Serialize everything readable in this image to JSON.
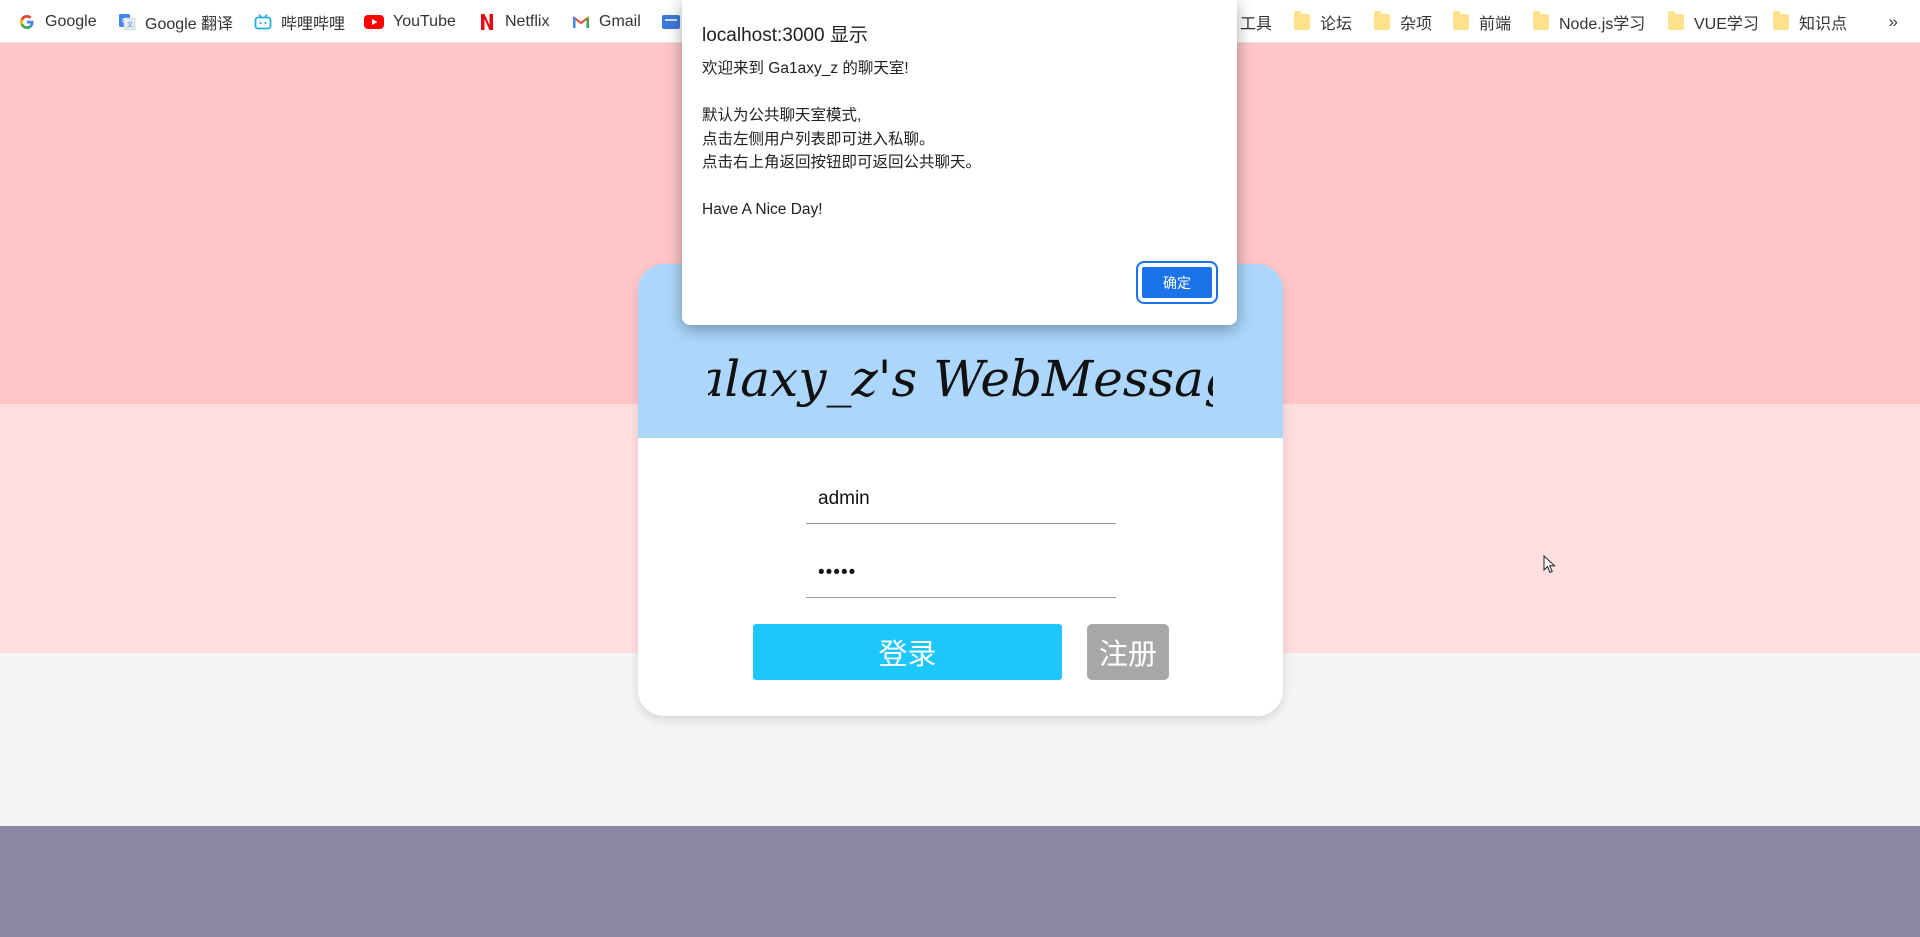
{
  "bookmarks": [
    {
      "label": "Google",
      "icon": "google-icon"
    },
    {
      "label": "Google 翻译",
      "icon": "google-translate-icon"
    },
    {
      "label": "哔哩哔哩",
      "icon": "bilibili-icon"
    },
    {
      "label": "YouTube",
      "icon": "youtube-icon"
    },
    {
      "label": "Netflix",
      "icon": "netflix-icon"
    },
    {
      "label": "Gmail",
      "icon": "gmail-icon"
    },
    {
      "label": "工具",
      "icon": "folder-icon"
    },
    {
      "label": "论坛",
      "icon": "folder-icon"
    },
    {
      "label": "杂项",
      "icon": "folder-icon"
    },
    {
      "label": "前端",
      "icon": "folder-icon"
    },
    {
      "label": "Node.js学习",
      "icon": "folder-icon"
    },
    {
      "label": "VUE学习",
      "icon": "folder-icon"
    },
    {
      "label": "知识点",
      "icon": "folder-icon"
    }
  ],
  "overflow_label": "»",
  "dialog": {
    "title": "localhost:3000 显示",
    "lines": [
      "欢迎来到 Ga1axy_z 的聊天室!",
      "",
      "默认为公共聊天室模式,",
      "点击左侧用户列表即可进入私聊。",
      "点击右上角返回按钮即可返回公共聊天。",
      "",
      "Have A Nice Day!"
    ],
    "ok_label": "确定"
  },
  "login": {
    "logo_text": "Galaxy_z's WebMessage",
    "username_value": "admin",
    "password_value": "•••••",
    "login_label": "登录",
    "register_label": "注册"
  },
  "colors": {
    "band1": "#ffc5c7",
    "band2": "#ffdedf",
    "band3": "#f4f4f4",
    "band4": "#8a88a3",
    "header": "#acd6fc",
    "login_button": "#1ec7fb",
    "register_button": "#a8a8a8",
    "dialog_button": "#1a73e8"
  }
}
